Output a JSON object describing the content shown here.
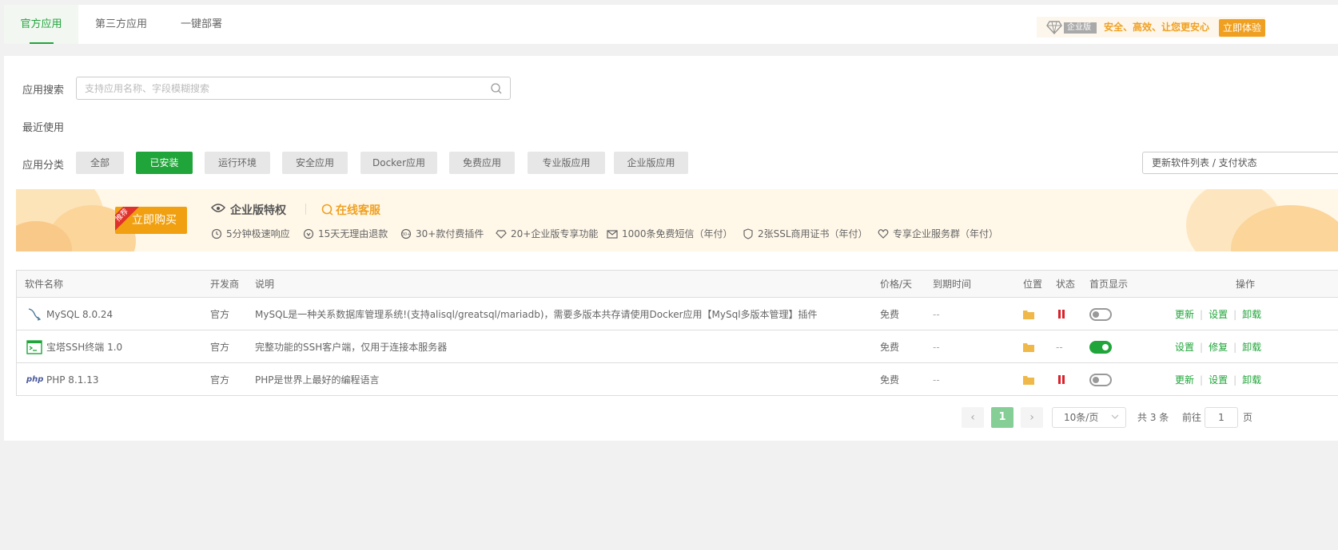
{
  "tabs": [
    {
      "label": "官方应用",
      "active": true
    },
    {
      "label": "第三方应用",
      "active": false
    },
    {
      "label": "一键部署",
      "active": false
    }
  ],
  "promo": {
    "badge": "企业版",
    "text": "安全、高效、让您更安心",
    "button": "立即体验"
  },
  "search": {
    "label": "应用搜索",
    "placeholder": "支持应用名称、字段模糊搜索",
    "value": ""
  },
  "recent": {
    "label": "最近使用"
  },
  "categories": {
    "label": "应用分类",
    "items": [
      "全部",
      "已安装",
      "运行环境",
      "安全应用",
      "Docker应用",
      "免费应用",
      "专业版应用",
      "企业版应用"
    ],
    "active": "已安装",
    "update_button": "更新软件列表 / 支付状态"
  },
  "banner": {
    "buy_button": "立即购买",
    "ribbon": "推荐",
    "title": "企业版特权",
    "service": "在线客服",
    "features": [
      "5分钟极速响应",
      "15天无理由退款",
      "30+款付费插件",
      "20+企业版专享功能",
      "1000条免费短信（年付）",
      "2张SSL商用证书（年付）",
      "专享企业服务群（年付）"
    ]
  },
  "table": {
    "headers": {
      "name": "软件名称",
      "developer": "开发商",
      "description": "说明",
      "price": "价格/天",
      "expire": "到期时间",
      "location": "位置",
      "status": "状态",
      "home_display": "首页显示",
      "actions": "操作"
    },
    "rows": [
      {
        "name": "MySQL 8.0.24",
        "icon": "mysql-icon",
        "developer": "官方",
        "description": "MySQL是一种关系数据库管理系统!(支持alisql/greatsql/mariadb)，需要多版本共存请使用Docker应用【MySql多版本管理】插件",
        "price": "免费",
        "expire": "--",
        "status": "paused",
        "status_text": "",
        "home_display": false,
        "actions": [
          "更新",
          "设置",
          "卸载"
        ]
      },
      {
        "name": "宝塔SSH终端 1.0",
        "icon": "terminal-icon",
        "developer": "官方",
        "description": "完整功能的SSH客户端，仅用于连接本服务器",
        "price": "免费",
        "expire": "--",
        "status": "none",
        "status_text": "--",
        "home_display": true,
        "actions": [
          "设置",
          "修复",
          "卸载"
        ]
      },
      {
        "name": "PHP 8.1.13",
        "icon": "php-icon",
        "icon_text": "php",
        "developer": "官方",
        "description": "PHP是世界上最好的编程语言",
        "price": "免费",
        "expire": "--",
        "status": "paused",
        "status_text": "",
        "home_display": false,
        "actions": [
          "更新",
          "设置",
          "卸载"
        ]
      }
    ]
  },
  "pagination": {
    "current": "1",
    "page_size": "10条/页",
    "total": "共 3 条",
    "goto_label": "前往",
    "goto_value": "1",
    "page_suffix": "页"
  },
  "colors": {
    "accent": "#20a53a",
    "warning": "#f0a020",
    "danger": "#d9222a"
  }
}
